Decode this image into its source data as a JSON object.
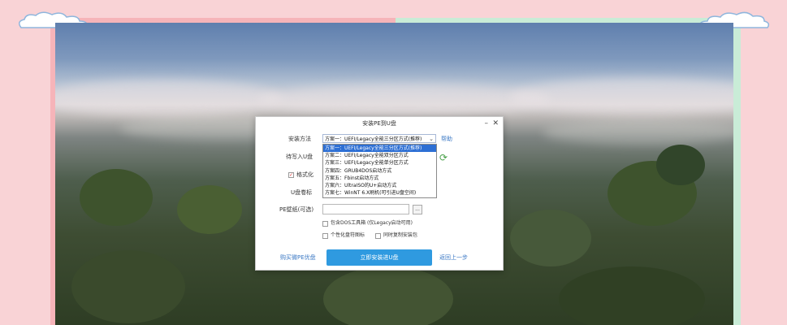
{
  "dialog": {
    "title": "安装PE到U盘",
    "minimize_glyph": "–",
    "close_glyph": "✕",
    "install_method": {
      "label": "安装方法",
      "selected": "方案一：UEFI/Legacy全能三分区方式(推荐)",
      "help_label": "帮助",
      "options": [
        "方案一：UEFI/Legacy全能三分区方式(推荐)",
        "方案二：UEFI/Legacy全能双分区方式",
        "方案三：UEFI/Legacy全能单分区方式",
        "方案四：GRUB4DOS启动方式",
        "方案五：Fbinst启动方式",
        "方案六：UltraISO的U+启动方式",
        "方案七：WinNT 6.X刷机(可引进U盘空间)"
      ]
    },
    "usb_label": "待写入U盘",
    "format_label": "格式化",
    "volume_label": "U盘卷标",
    "wallpaper_label": "PE壁纸(可选)",
    "browse_label": "...",
    "check_dos_tools": "包含DOS工具箱  (仅Legacy启动可用)",
    "check_custom_icon": "个性化盘符图标",
    "check_copy_driver": "同时复制安装包",
    "buy_link": "购买微PE优盘",
    "install_button": "立即安装进U盘",
    "back_link": "返回上一步"
  },
  "colors": {
    "page_bg": "#f9d3d6",
    "accent": "#2f9ae0",
    "link": "#3b78c4",
    "selection": "#2d6fd4"
  }
}
